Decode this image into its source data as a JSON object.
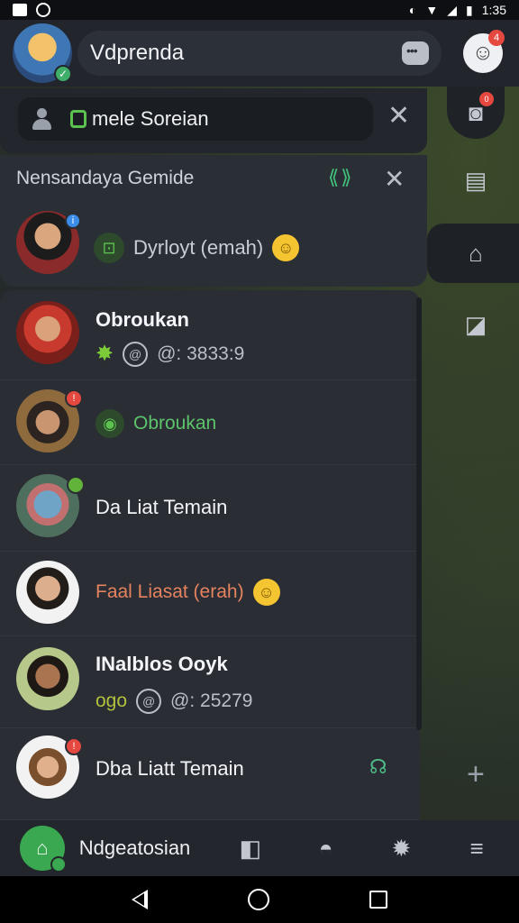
{
  "status": {
    "time": "1:35"
  },
  "header": {
    "title": "Vdprenda",
    "notification_count": "4"
  },
  "rail": {
    "bot_badge": "0"
  },
  "search": {
    "value": "mele Soreian"
  },
  "suggestion": {
    "title": "Nensandaya Gemide",
    "arrows": "⟪⟫",
    "line": "Dyrloyt (emah)"
  },
  "list": [
    {
      "name": "Obroukan",
      "sub": "@: 3833:9"
    },
    {
      "name": "Obroukan"
    },
    {
      "name": "Da Liat Temain"
    },
    {
      "name": "Faal Liasat (erah)"
    },
    {
      "name": "INalblos Ooyk",
      "sub_prefix": "ogo",
      "sub": "@: 25279"
    },
    {
      "name": "Dba Liatt Temain"
    }
  ],
  "bottombar": {
    "label": "Ndgeatosian"
  }
}
